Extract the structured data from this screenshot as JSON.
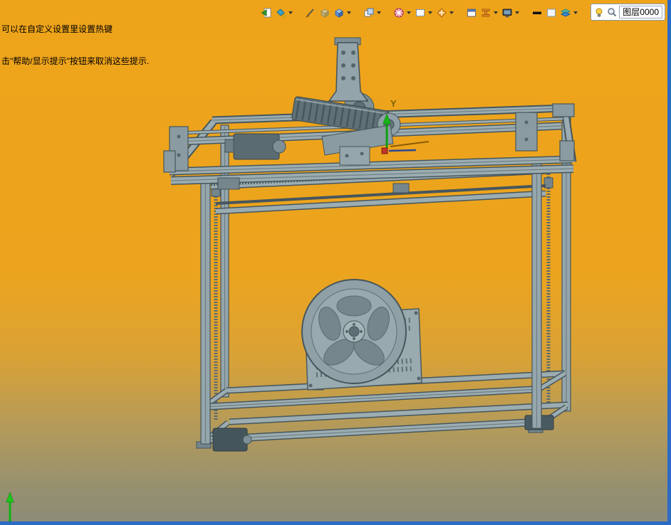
{
  "hints": {
    "line1": "可以在自定义设置里设置热键",
    "line2": "击\"帮助/显示提示\"按钮来取消这些提示."
  },
  "toolbar": {
    "items": [
      {
        "name": "back-page-icon",
        "dropdown": false
      },
      {
        "name": "paint-style-icon",
        "dropdown": true
      },
      {
        "name": "pen-icon",
        "dropdown": false
      },
      {
        "name": "extrude-cube-icon",
        "dropdown": false
      },
      {
        "name": "solid-cube-icon",
        "dropdown": true
      },
      {
        "name": "stacked-squares-icon",
        "dropdown": true
      },
      {
        "name": "pattern-wheel-icon",
        "dropdown": true
      },
      {
        "name": "selection-box-icon",
        "dropdown": true
      },
      {
        "name": "locate-target-icon",
        "dropdown": true
      },
      {
        "name": "window-icon",
        "dropdown": false
      },
      {
        "name": "h-beam-icon",
        "dropdown": true
      },
      {
        "name": "display-mode-icon",
        "dropdown": true
      },
      {
        "name": "line-width-icon",
        "dropdown": false
      },
      {
        "name": "color-swatch-icon",
        "dropdown": false
      },
      {
        "name": "layers-icon",
        "dropdown": true
      }
    ]
  },
  "layer_panel": {
    "bulb_icon": "lightbulb-icon",
    "search_icon": "magnifier-icon",
    "label": "图层0000"
  },
  "viewport": {
    "work_axis_label": "Y",
    "model_parts": [
      "machine-frame",
      "gantry-beam",
      "z-axis-assembly",
      "spindle-roller",
      "lead-screws",
      "pulley-wheel",
      "controller-panel",
      "bottom-motor",
      "work-coordinate-triad",
      "world-axis-indicator"
    ]
  },
  "colors": {
    "background_top": "#ECA41D",
    "background_bottom": "#8B8B78",
    "frame_light": "#9CADB2",
    "frame_dark": "#46565D",
    "window_border_blue": "#2D6AC4",
    "axis_green": "#18B418",
    "axis_label_olive": "#7A6200"
  }
}
